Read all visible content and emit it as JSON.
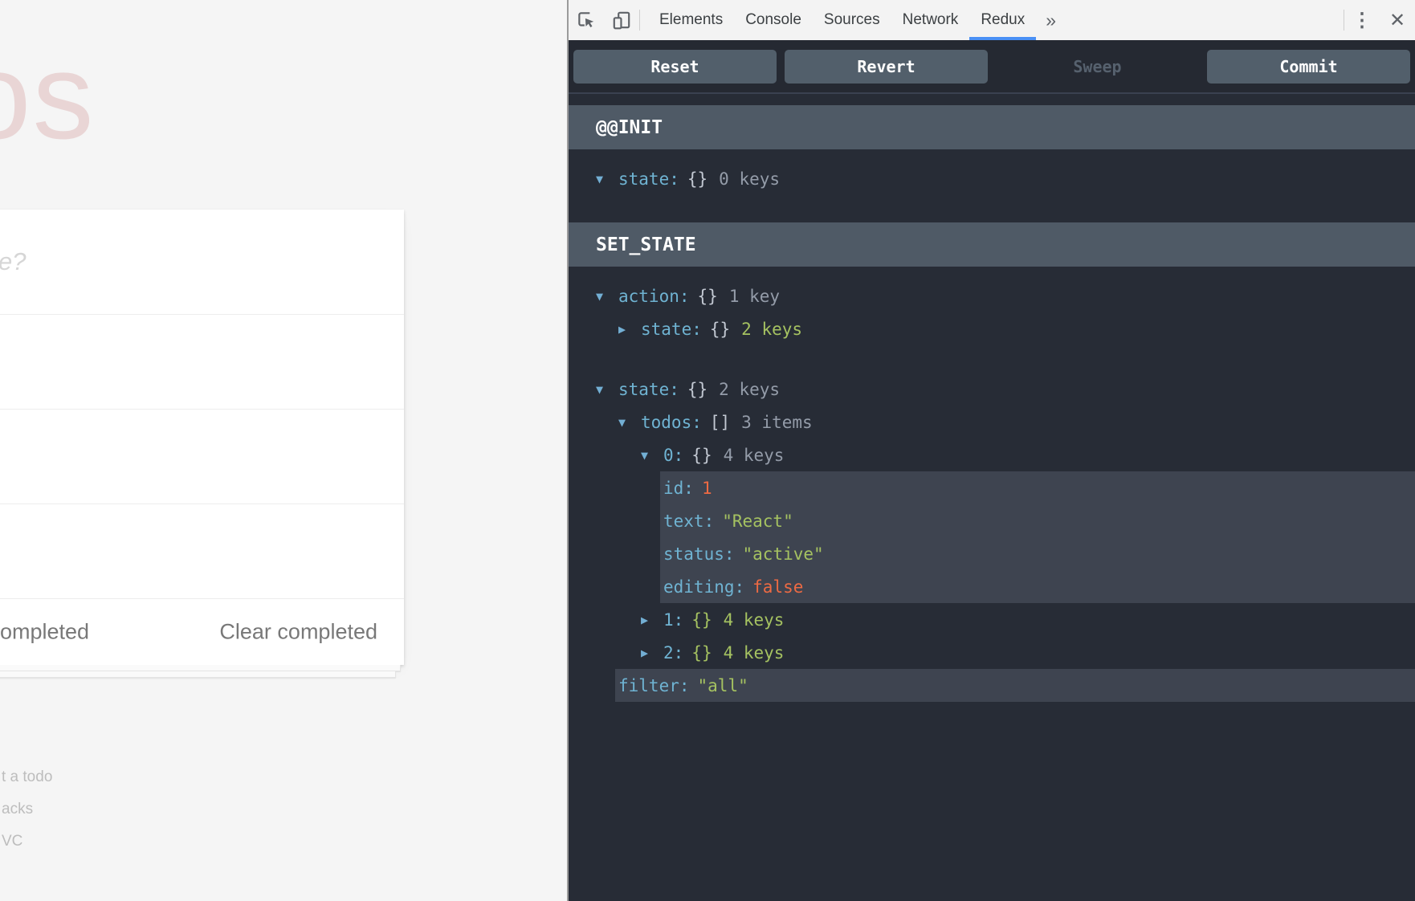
{
  "app": {
    "title_fragment": "os",
    "new_todo_placeholder_fragment": "e?",
    "footer": {
      "filter_fragment": "ompleted",
      "clear_completed": "Clear completed"
    },
    "info_lines": [
      "t a todo",
      "acks",
      "VC"
    ]
  },
  "devtools": {
    "tabs": [
      "Elements",
      "Console",
      "Sources",
      "Network",
      "Redux"
    ],
    "active_tab": "Redux",
    "more_tabs_glyph": "»",
    "kebab_glyph": "⋮",
    "close_glyph": "✕",
    "colors": {
      "accent_underline": "#4a90f5",
      "key": "#6fb3d2",
      "string_green": "#a5c261",
      "number_orange": "#ed6a43",
      "count_gray": "#949ca9",
      "header_bg": "#4f5a66",
      "log_bg": "#272c36",
      "highlight_bg": "#3e4450"
    },
    "toolbar": {
      "buttons": [
        {
          "label": "Reset",
          "enabled": true
        },
        {
          "label": "Revert",
          "enabled": true
        },
        {
          "label": "Sweep",
          "enabled": false
        },
        {
          "label": "Commit",
          "enabled": true
        }
      ]
    },
    "log": [
      {
        "action": "@@INIT",
        "rows": [
          {
            "key": "state",
            "level": 0,
            "arrow": "open",
            "braces": "{}",
            "braces_color": "braces",
            "count": "0 keys",
            "count_color": "gray"
          }
        ]
      },
      {
        "action": "SET_STATE",
        "rows": [
          {
            "key": "action",
            "level": 0,
            "arrow": "open",
            "braces": "{}",
            "braces_color": "braces",
            "count": "1 key",
            "count_color": "gray"
          },
          {
            "key": "state",
            "level": 1,
            "arrow": "closed",
            "braces": "{}",
            "braces_color": "braces",
            "count": "2 keys",
            "count_color": "green"
          },
          {
            "gap": true
          },
          {
            "key": "state",
            "level": 0,
            "arrow": "open",
            "braces": "{}",
            "braces_color": "braces",
            "count": "2 keys",
            "count_color": "gray"
          },
          {
            "key": "todos",
            "level": 1,
            "arrow": "open",
            "braces": "[]",
            "braces_color": "braces",
            "count": "3 items",
            "count_color": "gray"
          },
          {
            "key": "0",
            "level": 2,
            "arrow": "open",
            "braces": "{}",
            "braces_color": "braces",
            "count": "4 keys",
            "count_color": "gray"
          },
          {
            "key": "id",
            "level": 3,
            "value": "1",
            "value_color": "number",
            "hl": true
          },
          {
            "key": "text",
            "level": 3,
            "value": "\"React\"",
            "value_color": "string",
            "hl": true
          },
          {
            "key": "status",
            "level": 3,
            "value": "\"active\"",
            "value_color": "string",
            "hl": true
          },
          {
            "key": "editing",
            "level": 3,
            "value": "false",
            "value_color": "number",
            "hl": true
          },
          {
            "key": "1",
            "level": 2,
            "arrow": "closed",
            "braces": "{}",
            "braces_color": "green",
            "count": "4 keys",
            "count_color": "green"
          },
          {
            "key": "2",
            "level": 2,
            "arrow": "closed",
            "braces": "{}",
            "braces_color": "green",
            "count": "4 keys",
            "count_color": "green"
          },
          {
            "key": "filter",
            "level": 1,
            "value": "\"all\"",
            "value_color": "string",
            "hl": true
          }
        ]
      }
    ]
  }
}
